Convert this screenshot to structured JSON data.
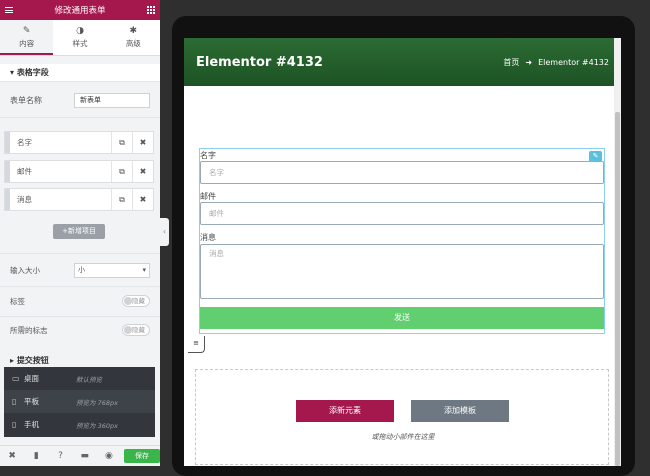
{
  "panel": {
    "title": "修改通用表单",
    "tabs": [
      {
        "label": "内容",
        "icon": "pencil-icon"
      },
      {
        "label": "样式",
        "icon": "contrast-icon"
      },
      {
        "label": "高级",
        "icon": "gear-icon"
      }
    ],
    "section_title": "表格字段",
    "form_name_label": "表单名称",
    "form_name_value": "新表单",
    "items": [
      {
        "label": "名字"
      },
      {
        "label": "邮件"
      },
      {
        "label": "消息"
      }
    ],
    "add_item_label": "+新增项目",
    "input_size_label": "输入大小",
    "input_size_value": "小",
    "label_label": "标签",
    "label_toggle": "隐藏",
    "required_label": "所需的标志",
    "required_toggle": "隐藏",
    "partial_section": "提交按钮",
    "devices": [
      {
        "name": "桌面",
        "desc": "默认预览",
        "icon": "desktop-icon"
      },
      {
        "name": "平板",
        "desc": "预览为 768px",
        "icon": "tablet-icon"
      },
      {
        "name": "手机",
        "desc": "预览为 360px",
        "icon": "mobile-icon"
      }
    ],
    "save_label": "保存"
  },
  "preview": {
    "site_title": "Elementor #4132",
    "breadcrumb_home": "首页",
    "breadcrumb_sep": "➜",
    "breadcrumb_current": "Elementor #4132",
    "fields": [
      {
        "label": "名字",
        "placeholder": "名字"
      },
      {
        "label": "邮件",
        "placeholder": "邮件"
      },
      {
        "label": "消息",
        "placeholder": "消息"
      }
    ],
    "send_label": "发送",
    "add_element_label": "添新元素",
    "add_template_label": "添加模板",
    "drop_text": "或拖动小部件在这里"
  },
  "colors": {
    "accent": "#a4184d",
    "header": "#245f2b",
    "send": "#61ce70",
    "save": "#39b54a"
  }
}
